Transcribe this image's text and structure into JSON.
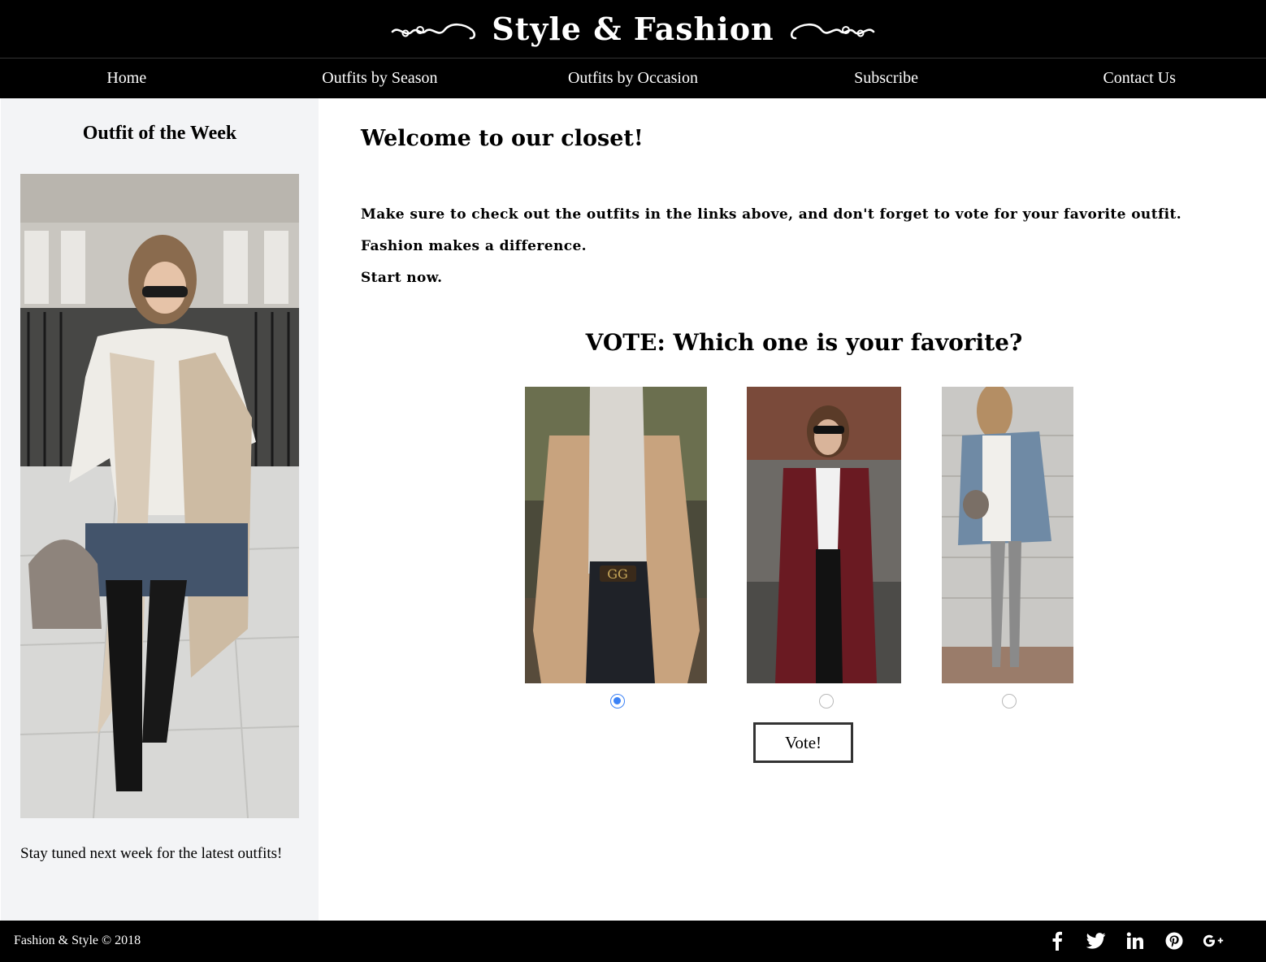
{
  "header": {
    "title": "Style & Fashion"
  },
  "nav": {
    "items": [
      {
        "label": "Home"
      },
      {
        "label": "Outfits by Season"
      },
      {
        "label": "Outfits by Occasion"
      },
      {
        "label": "Subscribe"
      },
      {
        "label": "Contact Us"
      }
    ]
  },
  "sidebar": {
    "title": "Outfit of the Week",
    "photo_icon": "outfit-of-week-photo",
    "note": "Stay tuned next week for the latest outfits!"
  },
  "main": {
    "welcome_title": "Welcome to our closet!",
    "intro_lines": [
      "Make sure to check out the outfits in the links above, and don't forget to vote for your favorite outfit.",
      "Fashion makes a difference.",
      "Start now."
    ],
    "vote_title": "VOTE: Which one is your favorite?",
    "options": [
      {
        "photo": "camel-coat-outfit",
        "selected": true
      },
      {
        "photo": "burgundy-coat-outfit",
        "selected": false
      },
      {
        "photo": "blue-coat-outfit",
        "selected": false
      }
    ],
    "vote_button": "Vote!"
  },
  "footer": {
    "copyright": "Fashion & Style © 2018",
    "social_icons": [
      "facebook-icon",
      "twitter-icon",
      "linkedin-icon",
      "pinterest-icon",
      "google-plus-icon"
    ]
  },
  "colors": {
    "header_bg": "#000000",
    "sidebar_bg": "#f3f4f6",
    "radio_accent": "#3b82f6"
  }
}
